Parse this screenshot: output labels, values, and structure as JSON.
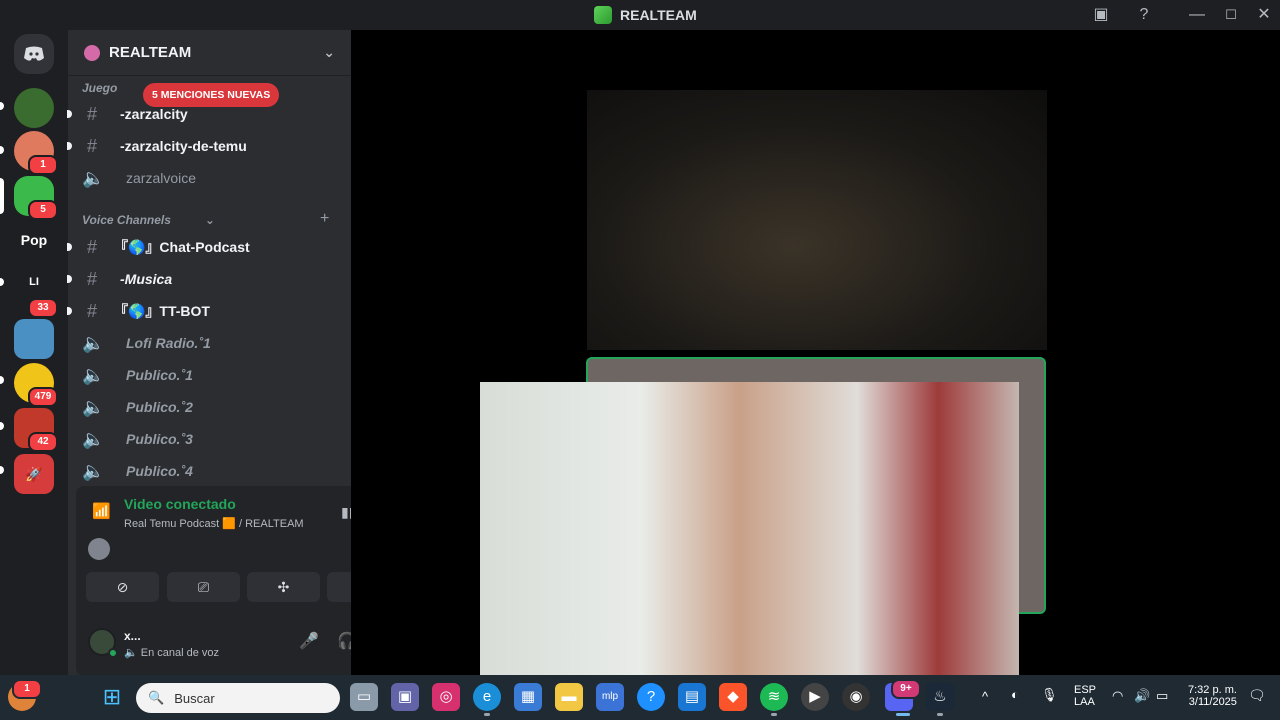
{
  "titlebar": {
    "app_title": "REALTEAM"
  },
  "rail": {
    "badges": [
      "1",
      "5",
      "33",
      "479",
      "42"
    ],
    "pop_label": "Pop",
    "li_label": "LI"
  },
  "guild": {
    "name": "REALTEAM"
  },
  "mention_pill": "5 MENCIONES NUEVAS",
  "categories": {
    "juegos": "Juego",
    "voice": "Voice Channels"
  },
  "channels": [
    {
      "label": "-zarzalcity",
      "type": "text",
      "unread": true
    },
    {
      "label": "-zarzalcity-de-temu",
      "type": "text",
      "unread": true
    },
    {
      "label": "zarzalvoice",
      "type": "voice",
      "unread": false
    },
    {
      "label": "『🌎』Chat-Podcast",
      "type": "text",
      "unread": true
    },
    {
      "label": "-Musica",
      "type": "text",
      "unread": true
    },
    {
      "label": "『🌎』TT-BOT",
      "type": "text",
      "unread": true
    },
    {
      "label": "Lofi Radio.˚1",
      "type": "voice",
      "unread": false
    },
    {
      "label": "Publico.˚1",
      "type": "voice",
      "unread": false
    },
    {
      "label": "Publico.˚2",
      "type": "voice",
      "unread": false
    },
    {
      "label": "Publico.˚3",
      "type": "voice",
      "unread": false
    },
    {
      "label": "Publico.˚4",
      "type": "voice",
      "unread": false
    }
  ],
  "voice_panel": {
    "status": "Video conectado",
    "channel": "Real Temu Podcast 🟧 / REALTEAM"
  },
  "user": {
    "name": "x...",
    "status": "En canal de voz"
  },
  "taskbar": {
    "search_placeholder": "Buscar",
    "lang_1": "ESP",
    "lang_2": "LAA",
    "time": "7:32 p. m.",
    "date": "3/11/2025",
    "notif_badge": "1",
    "discord_badge": "9+"
  },
  "colors": {
    "connected_green": "#23a55a",
    "mention_red": "#da373c",
    "sidebar_bg": "#2b2d31"
  }
}
